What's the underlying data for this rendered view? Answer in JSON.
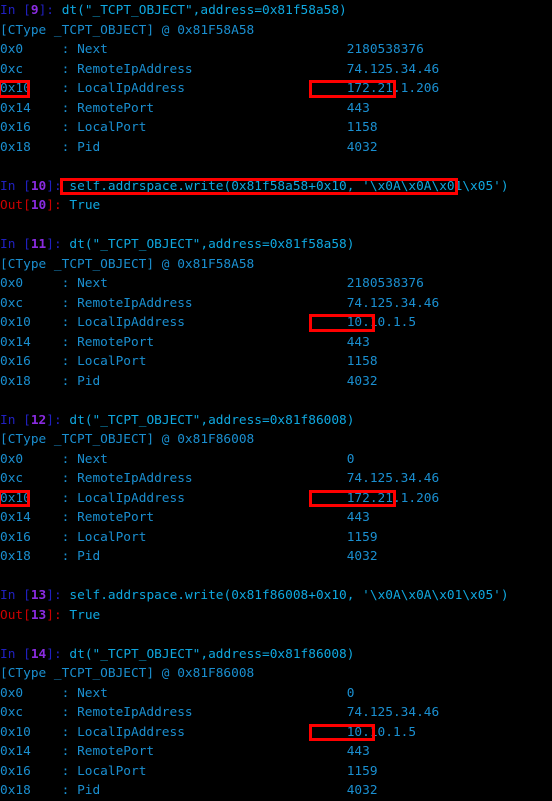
{
  "terminal": {
    "app": "IPython console",
    "background_color": "#000000",
    "code_color": "#0fa8e0",
    "prompt_in_color": "#2020c0",
    "prompt_out_color": "#cc0000",
    "prompt_number_color": "#8a2be2",
    "highlight_color": "#ff0000",
    "prompt_in_label": "In ",
    "prompt_out_label": "Out",
    "bracket_open": "[",
    "bracket_close": "]",
    "colon": ": ",
    "field_separator": ":"
  },
  "blocks": [
    {
      "id": "block-9",
      "prompt_type": "In",
      "prompt_number": "9",
      "command": "dt(\"_TCPT_OBJECT\",address=0x81f58a58)",
      "command_highlighted": false,
      "header": "[CType _TCPT_OBJECT] @ 0x81F58A58",
      "rows": [
        {
          "offset": "0x0",
          "name": "Next",
          "value": "2180538376",
          "offset_highlighted": false,
          "value_highlighted": false
        },
        {
          "offset": "0xc",
          "name": "RemoteIpAddress",
          "value": "74.125.34.46",
          "offset_highlighted": false,
          "value_highlighted": false
        },
        {
          "offset": "0x10",
          "name": "LocalIpAddress",
          "value": "172.21.1.206",
          "offset_highlighted": true,
          "value_highlighted": true
        },
        {
          "offset": "0x14",
          "name": "RemotePort",
          "value": "443",
          "offset_highlighted": false,
          "value_highlighted": false
        },
        {
          "offset": "0x16",
          "name": "LocalPort",
          "value": "1158",
          "offset_highlighted": false,
          "value_highlighted": false
        },
        {
          "offset": "0x18",
          "name": "Pid",
          "value": "4032",
          "offset_highlighted": false,
          "value_highlighted": false
        }
      ]
    },
    {
      "id": "block-10",
      "prompt_type": "In",
      "prompt_number": "10",
      "command": "self.addrspace.write(0x81f58a58+0x10, '\\x0A\\x0A\\x01\\x05')",
      "command_highlighted": true,
      "output_number": "10",
      "output_value": "True"
    },
    {
      "id": "block-11",
      "prompt_type": "In",
      "prompt_number": "11",
      "command": "dt(\"_TCPT_OBJECT\",address=0x81f58a58)",
      "command_highlighted": false,
      "header": "[CType _TCPT_OBJECT] @ 0x81F58A58",
      "rows": [
        {
          "offset": "0x0",
          "name": "Next",
          "value": "2180538376",
          "offset_highlighted": false,
          "value_highlighted": false
        },
        {
          "offset": "0xc",
          "name": "RemoteIpAddress",
          "value": "74.125.34.46",
          "offset_highlighted": false,
          "value_highlighted": false
        },
        {
          "offset": "0x10",
          "name": "LocalIpAddress",
          "value": "10.10.1.5",
          "offset_highlighted": false,
          "value_highlighted": true
        },
        {
          "offset": "0x14",
          "name": "RemotePort",
          "value": "443",
          "offset_highlighted": false,
          "value_highlighted": false
        },
        {
          "offset": "0x16",
          "name": "LocalPort",
          "value": "1158",
          "offset_highlighted": false,
          "value_highlighted": false
        },
        {
          "offset": "0x18",
          "name": "Pid",
          "value": "4032",
          "offset_highlighted": false,
          "value_highlighted": false
        }
      ]
    },
    {
      "id": "block-12",
      "prompt_type": "In",
      "prompt_number": "12",
      "command": "dt(\"_TCPT_OBJECT\",address=0x81f86008)",
      "command_highlighted": false,
      "header": "[CType _TCPT_OBJECT] @ 0x81F86008",
      "rows": [
        {
          "offset": "0x0",
          "name": "Next",
          "value": "0",
          "offset_highlighted": false,
          "value_highlighted": false
        },
        {
          "offset": "0xc",
          "name": "RemoteIpAddress",
          "value": "74.125.34.46",
          "offset_highlighted": false,
          "value_highlighted": false
        },
        {
          "offset": "0x10",
          "name": "LocalIpAddress",
          "value": "172.21.1.206",
          "offset_highlighted": true,
          "value_highlighted": true
        },
        {
          "offset": "0x14",
          "name": "RemotePort",
          "value": "443",
          "offset_highlighted": false,
          "value_highlighted": false
        },
        {
          "offset": "0x16",
          "name": "LocalPort",
          "value": "1159",
          "offset_highlighted": false,
          "value_highlighted": false
        },
        {
          "offset": "0x18",
          "name": "Pid",
          "value": "4032",
          "offset_highlighted": false,
          "value_highlighted": false
        }
      ]
    },
    {
      "id": "block-13",
      "prompt_type": "In",
      "prompt_number": "13",
      "command": "self.addrspace.write(0x81f86008+0x10, '\\x0A\\x0A\\x01\\x05')",
      "command_highlighted": false,
      "output_number": "13",
      "output_value": "True"
    },
    {
      "id": "block-14",
      "prompt_type": "In",
      "prompt_number": "14",
      "command": "dt(\"_TCPT_OBJECT\",address=0x81f86008)",
      "command_highlighted": false,
      "header": "[CType _TCPT_OBJECT] @ 0x81F86008",
      "rows": [
        {
          "offset": "0x0",
          "name": "Next",
          "value": "0",
          "offset_highlighted": false,
          "value_highlighted": false
        },
        {
          "offset": "0xc",
          "name": "RemoteIpAddress",
          "value": "74.125.34.46",
          "offset_highlighted": false,
          "value_highlighted": false
        },
        {
          "offset": "0x10",
          "name": "LocalIpAddress",
          "value": "10.10.1.5",
          "offset_highlighted": false,
          "value_highlighted": true
        },
        {
          "offset": "0x14",
          "name": "RemotePort",
          "value": "443",
          "offset_highlighted": false,
          "value_highlighted": false
        },
        {
          "offset": "0x16",
          "name": "LocalPort",
          "value": "1159",
          "offset_highlighted": false,
          "value_highlighted": false
        },
        {
          "offset": "0x18",
          "name": "Pid",
          "value": "4032",
          "offset_highlighted": false,
          "value_highlighted": false
        }
      ]
    }
  ]
}
